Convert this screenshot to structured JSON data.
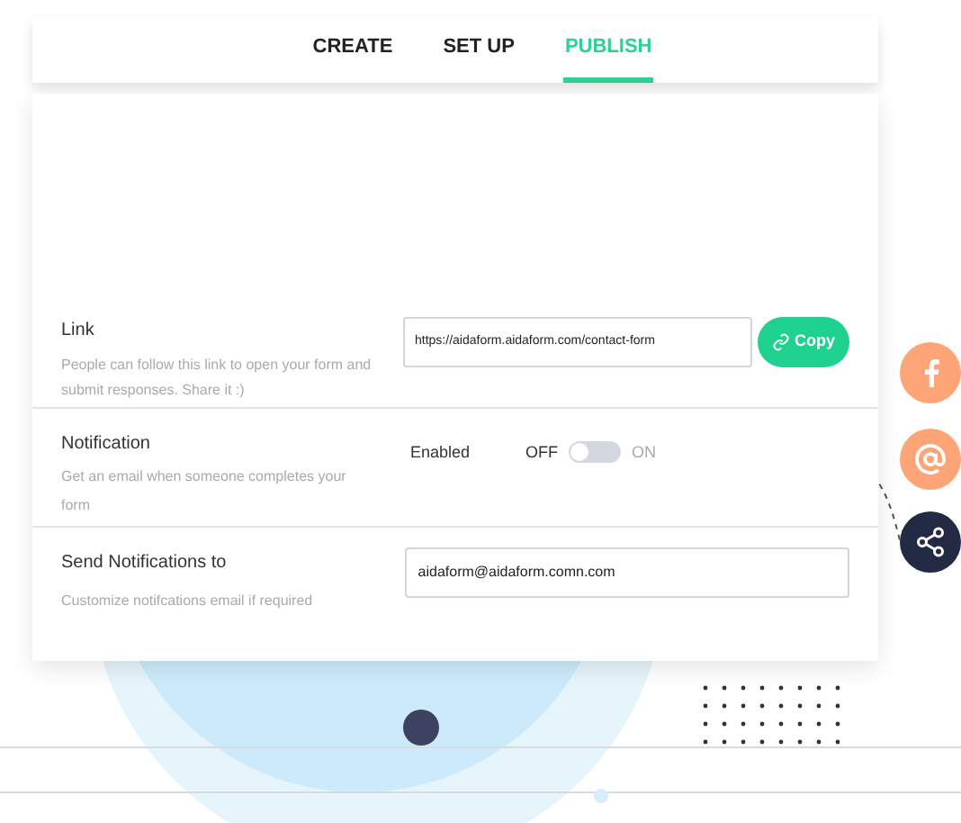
{
  "tabs": [
    {
      "label": "CREATE",
      "selected": false
    },
    {
      "label": "SET UP",
      "selected": false
    },
    {
      "label": "PUBLISH",
      "selected": true
    }
  ],
  "link": {
    "title": "Link",
    "description": "People can follow this link to open your form and submit responses. Share it :)",
    "value": "https://aidaform.aidaform.com/contact-form",
    "button": "Copy"
  },
  "notification": {
    "title": "Notification",
    "description": "Get an email when someone completes your form",
    "status": "Enabled",
    "off_label": "OFF",
    "on_label": "ON",
    "on": false
  },
  "send_to": {
    "title": "Send Notifications to",
    "description": "Customize notifcations email if required",
    "value": "aidaform@aidaform.comn.com"
  }
}
